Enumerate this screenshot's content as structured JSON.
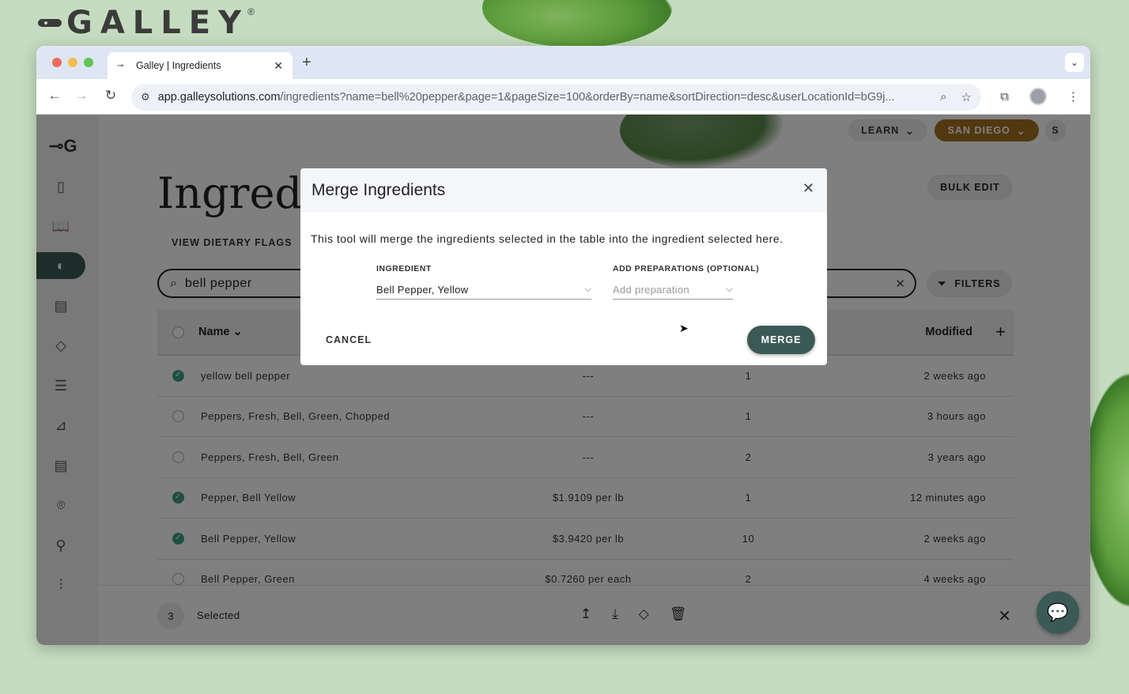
{
  "background": {
    "brand": "GALLEY",
    "brand_mark": "®"
  },
  "browser": {
    "tab_title": "Galley | Ingredients",
    "url_host": "app.galleysolutions.com",
    "url_path": "/ingredients?name=bell%20pepper&page=1&pageSize=100&orderBy=name&sortDirection=desc&userLocationId=bG9j..."
  },
  "header": {
    "learn_label": "LEARN",
    "location_label": "SAN DIEGO",
    "user_initial": "S"
  },
  "page": {
    "title": "Ingredients",
    "bulk_edit_label": "BULK EDIT",
    "dietary_flags_label": "VIEW DIETARY FLAGS",
    "search_value": "bell pepper",
    "filters_label": "FILTERS"
  },
  "table": {
    "columns": {
      "name": "Name",
      "modified": "Modified"
    },
    "rows": [
      {
        "name": "yellow bell pepper",
        "cost": "---",
        "count": "1",
        "modified": "2 weeks ago",
        "checked": true
      },
      {
        "name": "Peppers, Fresh, Bell, Green, Chopped",
        "cost": "---",
        "count": "1",
        "modified": "3 hours ago",
        "checked": false
      },
      {
        "name": "Peppers, Fresh, Bell, Green",
        "cost": "---",
        "count": "2",
        "modified": "3 years ago",
        "checked": false
      },
      {
        "name": "Pepper, Bell Yellow",
        "cost": "$1.9109 per lb",
        "count": "1",
        "modified": "12 minutes ago",
        "checked": true
      },
      {
        "name": "Bell Pepper, Yellow",
        "cost": "$3.9420 per lb",
        "count": "10",
        "modified": "2 weeks ago",
        "checked": true
      },
      {
        "name": "Bell Pepper, Green",
        "cost": "$0.7260 per each",
        "count": "2",
        "modified": "4 weeks ago",
        "checked": false
      }
    ]
  },
  "bottom_bar": {
    "selected_count": "3",
    "selected_label": "Selected"
  },
  "modal": {
    "title": "Merge Ingredients",
    "description": "This tool will merge the ingredients selected in the table into the ingredient selected here.",
    "ingredient_label": "INGREDIENT",
    "ingredient_value": "Bell Pepper, Yellow",
    "preparations_label": "ADD PREPARATIONS (OPTIONAL)",
    "preparations_placeholder": "Add preparation",
    "cancel_label": "CANCEL",
    "merge_label": "MERGE"
  },
  "colors": {
    "accent_dark_green": "#3c5a55",
    "location_brown": "#a5701f",
    "check_green": "#3f9e86"
  }
}
